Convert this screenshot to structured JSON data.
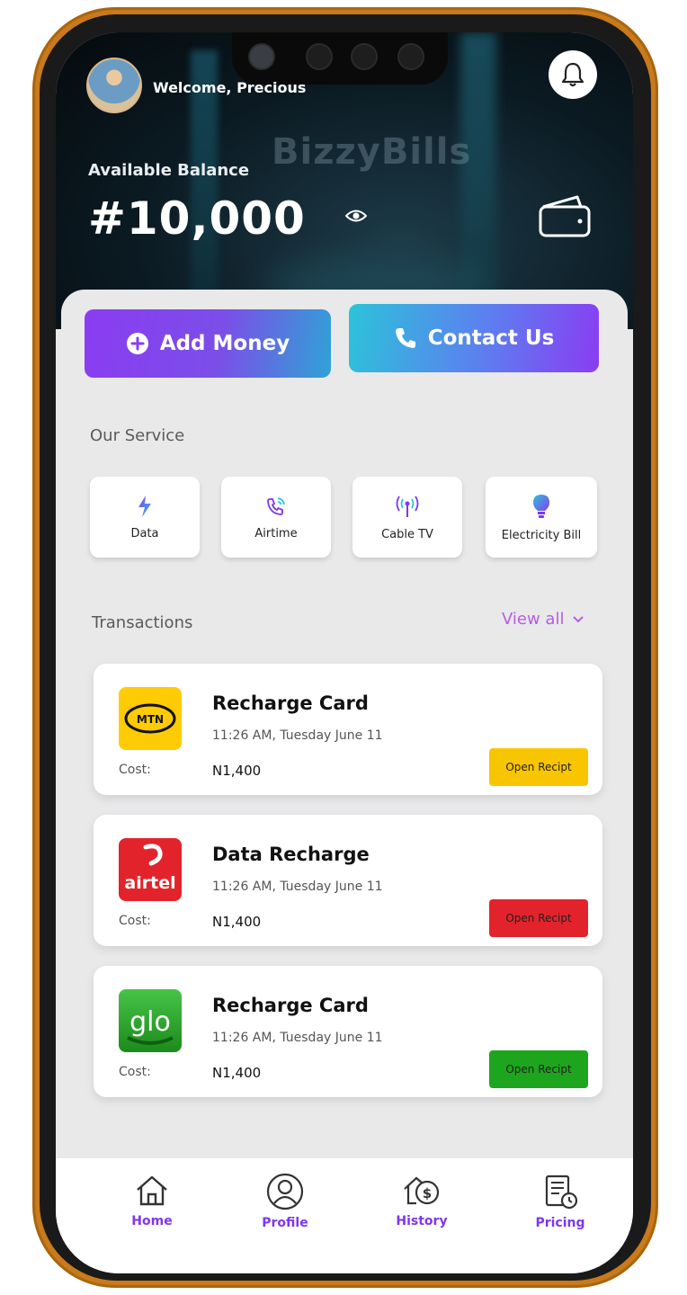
{
  "header": {
    "welcome_text": "Welcome,  Precious",
    "brand_watermark": "BizzyBills",
    "balance_label": "Available Balance",
    "balance_amount": "#10,000"
  },
  "actions": {
    "add_money_label": "Add Money",
    "contact_us_label": "Contact Us"
  },
  "services": {
    "title": "Our Service",
    "items": [
      {
        "label": "Data",
        "icon": "lightning-icon"
      },
      {
        "label": "Airtime",
        "icon": "phone-call-icon"
      },
      {
        "label": "Cable TV",
        "icon": "antenna-icon"
      },
      {
        "label": "Electricity Bill",
        "icon": "bulb-icon"
      }
    ]
  },
  "transactions": {
    "title": "Transactions",
    "view_all_label": "View all",
    "items": [
      {
        "provider": "MTN",
        "title": "Recharge Card",
        "time": "11:26 AM, Tuesday June 11",
        "cost_label": "Cost:",
        "cost": "N1,400",
        "button_label": "Open Recipt",
        "button_color": "#f7c600",
        "logo_color": "#ffcb05"
      },
      {
        "provider": "airtel",
        "title": "Data Recharge",
        "time": "11:26 AM, Tuesday June 11",
        "cost_label": "Cost:",
        "cost": "N1,400",
        "button_label": "Open Recipt",
        "button_color": "#e3232b",
        "logo_color": "#e3232b"
      },
      {
        "provider": "glo",
        "title": "Recharge Card",
        "time": "11:26 AM, Tuesday June 11",
        "cost_label": "Cost:",
        "cost": "N1,400",
        "button_label": "Open Recipt",
        "button_color": "#1ea51e",
        "logo_color": "#2aa82a"
      }
    ]
  },
  "nav": {
    "items": [
      {
        "label": "Home",
        "icon": "home-icon"
      },
      {
        "label": "Profile",
        "icon": "user-icon"
      },
      {
        "label": "History",
        "icon": "history-icon"
      },
      {
        "label": "Pricing",
        "icon": "pricing-icon"
      }
    ]
  },
  "colors": {
    "accent_purple": "#7e36ee",
    "accent_cyan": "#2cc3d9",
    "frame_gold": "#c97a1c"
  }
}
